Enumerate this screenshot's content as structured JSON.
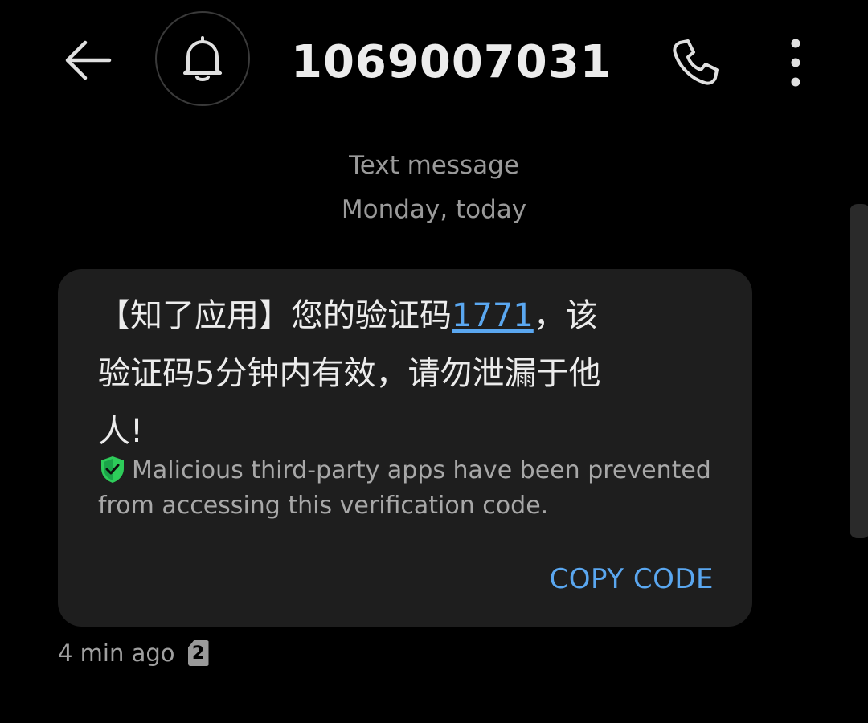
{
  "header": {
    "title": "1069007031..."
  },
  "conversation": {
    "message_type": "Text message",
    "date_label": "Monday, today"
  },
  "message": {
    "line1_before_code": "【知了应用】您的验证码",
    "code": "1771",
    "line1_after_code": "，该",
    "line2": "验证码5分钟内有效，请勿泄漏于他",
    "line3": "人!",
    "security_note": "Malicious third-party apps have been prevented from accessing this verification code.",
    "copy_code_label": "COPY CODE",
    "timestamp": "4 min ago",
    "sim_slot": "2"
  },
  "colors": {
    "background": "#000000",
    "bubble": "#1e1e1e",
    "accent": "#5aa7f0",
    "shield": "#2ecc5a"
  },
  "icons": {
    "back": "arrow-left-icon",
    "notification": "bell-icon",
    "call": "phone-icon",
    "more": "more-vertical-icon",
    "security": "shield-check-icon",
    "sim": "sim-card-icon"
  }
}
